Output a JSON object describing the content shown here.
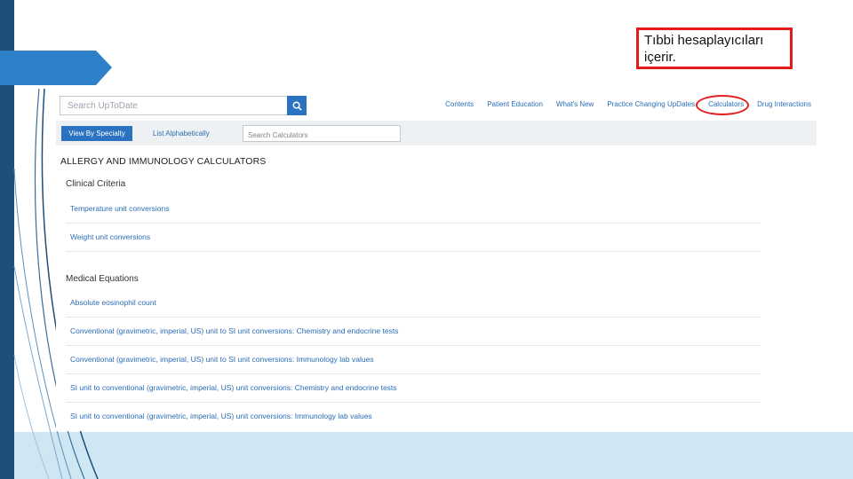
{
  "slide": {
    "note": "Tıbbi hesaplayıcıları içerir."
  },
  "search": {
    "placeholder": "Search UpToDate"
  },
  "nav": {
    "links": [
      "Contents",
      "Patient Education",
      "What's New",
      "Practice Changing UpDates",
      "Calculators",
      "Drug Interactions"
    ]
  },
  "subbar": {
    "specialty_button": "View By Specialty",
    "alphabetical_link": "List Alphabetically",
    "search_placeholder": "Search Calculators"
  },
  "page": {
    "heading": "ALLERGY AND IMMUNOLOGY CALCULATORS"
  },
  "sections": [
    {
      "title": "Clinical Criteria",
      "items": [
        "Temperature unit conversions",
        "Weight unit conversions"
      ]
    },
    {
      "title": "Medical Equations",
      "items": [
        "Absolute eosinophil count",
        "Conventional (gravimetric, imperial, US) unit to SI unit conversions: Chemistry and endocrine tests",
        "Conventional (gravimetric, imperial, US) unit to SI unit conversions: Immunology lab values",
        "SI unit to conventional (gravimetric, imperial, US) unit conversions: Chemistry and endocrine tests",
        "SI unit to conventional (gravimetric, imperial, US) unit conversions: Immunology lab values"
      ]
    }
  ],
  "colors": {
    "accent": "#2b73c0",
    "link": "#2a6db5",
    "highlight": "#e41b1b",
    "slide_bar": "#1f4e79",
    "slide_band": "#cfe6f3"
  },
  "icons": {
    "search_button": "search-icon"
  }
}
